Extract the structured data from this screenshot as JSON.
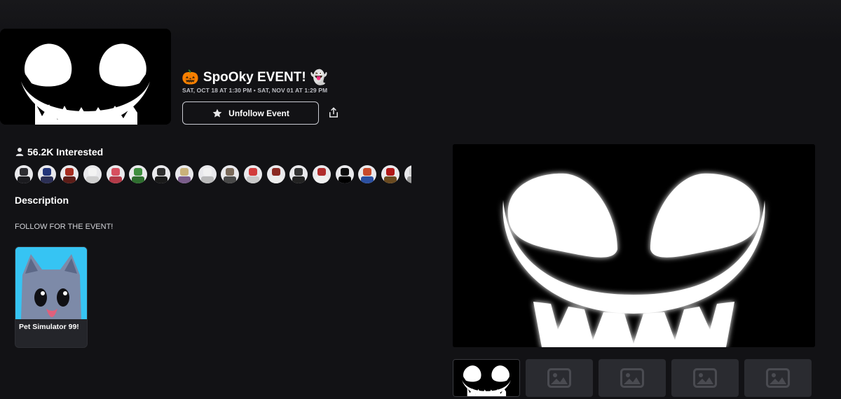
{
  "event": {
    "title": "SpoOky EVENT!",
    "title_prefix_emoji": "🎃",
    "title_suffix_emoji": "👻",
    "dates": "SAT, OCT 18 AT 1:30 PM • SAT, NOV 01 AT 1:29 PM",
    "follow_button_label": "Unfollow Event",
    "follow_icon": "star-icon",
    "share_icon": "share-icon"
  },
  "interested": {
    "label": "56.2K Interested",
    "icon": "person-icon",
    "avatars": [
      {
        "head": "#2c2c30",
        "body": "#1b1b1f"
      },
      {
        "head": "#23357a",
        "body": "#2b2f55"
      },
      {
        "head": "#a52c1f",
        "body": "#5d1d18"
      },
      {
        "head": "#f3f3f3",
        "body": "#cfcfcf"
      },
      {
        "head": "#d74f5f",
        "body": "#b33a48"
      },
      {
        "head": "#3f8f3f",
        "body": "#2f6e2f"
      },
      {
        "head": "#2e2e2e",
        "body": "#1a1a1a"
      },
      {
        "head": "#c9b27a",
        "body": "#7a5d8a"
      },
      {
        "head": "#f1f1f1",
        "body": "#b9b9b9"
      },
      {
        "head": "#7a6a5a",
        "body": "#4a4a4a"
      },
      {
        "head": "#d23c3c",
        "body": "#c9c9c9"
      },
      {
        "head": "#8b2a22",
        "body": "#ededed"
      },
      {
        "head": "#343434",
        "body": "#222222"
      },
      {
        "head": "#b02c2c",
        "body": "#f0f0f0"
      },
      {
        "head": "#0b0b0b",
        "body": "#000000"
      },
      {
        "head": "#c94a2a",
        "body": "#2b4fa0"
      },
      {
        "head": "#b01818",
        "body": "#6a4a20"
      },
      {
        "head": "#cfcfcf",
        "body": "#9a9a9a"
      }
    ]
  },
  "description": {
    "heading": "Description",
    "text": "FOLLOW FOR THE EVENT!"
  },
  "game": {
    "name": "Pet Simulator 99!"
  },
  "media": {
    "placeholder_icon": "image-placeholder-icon",
    "thumbnail_count": 5
  }
}
